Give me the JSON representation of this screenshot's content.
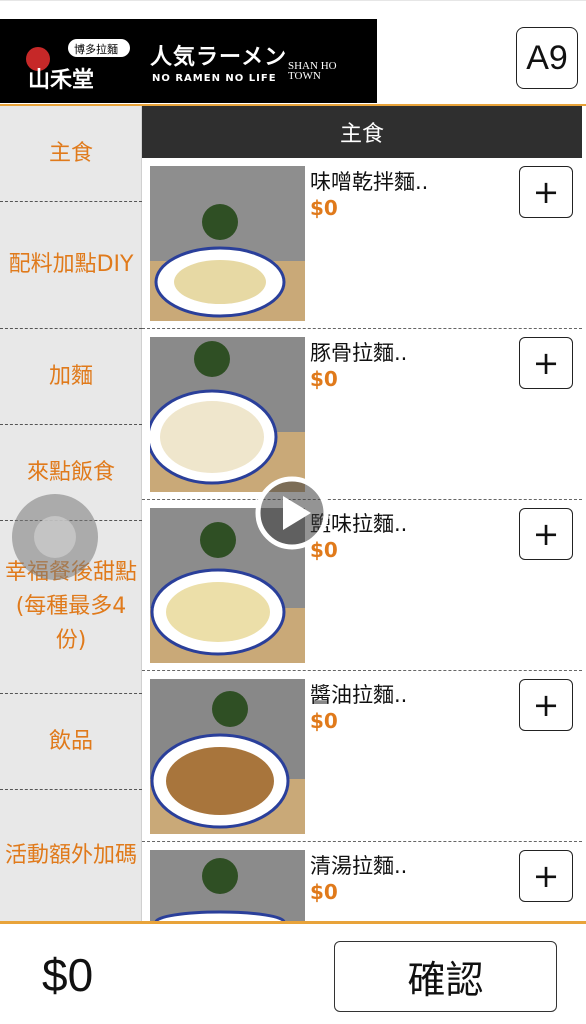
{
  "header": {
    "brand_title": "人気ラーメン",
    "brand_tagline": "NO RAMEN NO LIFE",
    "brand_sub_line1": "SHAN HO",
    "brand_sub_line2": "TOWN",
    "logo_text": "山禾堂",
    "table_code": "A9"
  },
  "sidebar": {
    "categories": [
      {
        "label": "主食"
      },
      {
        "label": "配料加點DIY"
      },
      {
        "label": "加麵"
      },
      {
        "label": "來點飯食"
      },
      {
        "label": "幸福餐後甜點(每種最多4份)"
      },
      {
        "label": "飲品"
      },
      {
        "label": "活動額外加碼"
      }
    ]
  },
  "main": {
    "section_title": "主食",
    "items": [
      {
        "name": "味噌乾拌麵..",
        "price": "$0",
        "add_label": "+"
      },
      {
        "name": "豚骨拉麵..",
        "price": "$0",
        "add_label": "+"
      },
      {
        "name": "鹽味拉麵..",
        "price": "$0",
        "add_label": "+"
      },
      {
        "name": "醬油拉麵..",
        "price": "$0",
        "add_label": "+"
      },
      {
        "name": "清湯拉麵..",
        "price": "$0",
        "add_label": "+"
      }
    ]
  },
  "footer": {
    "total": "$0",
    "confirm_label": "確認"
  },
  "colors": {
    "accent": "#e07a1b",
    "rule": "#e8a33a",
    "header_bar": "#2f2f2f"
  },
  "icons": [
    "plus-icon",
    "play-icon",
    "assistive-touch-icon"
  ]
}
